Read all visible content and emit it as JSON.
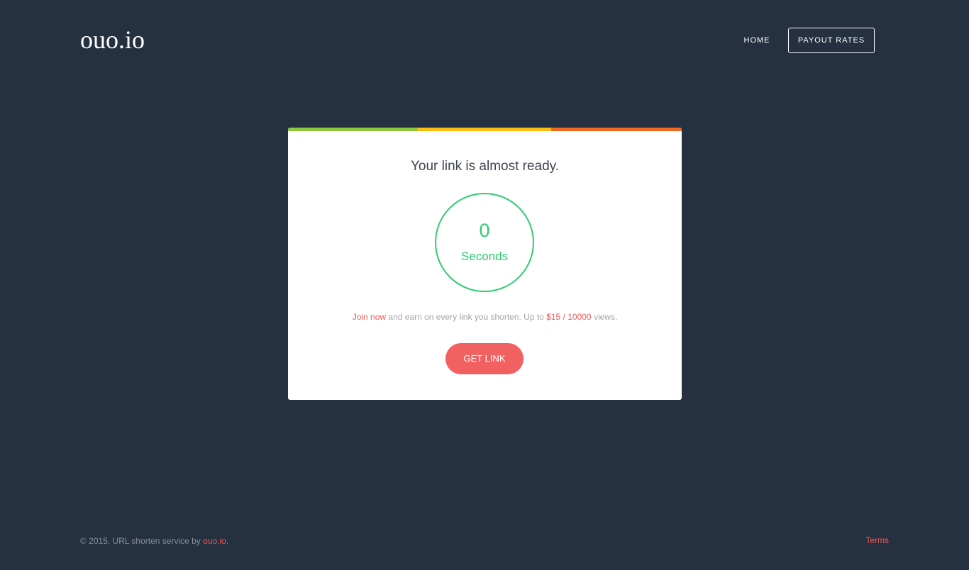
{
  "header": {
    "logo": "ouo.io",
    "nav": {
      "home": "HOME",
      "payout": "PAYOUT RATES"
    }
  },
  "card": {
    "bar_colors": {
      "green": "#8dc63f",
      "yellow": "#fbbc14",
      "orange": "#f26722"
    },
    "title": "Your link is almost ready.",
    "timer": {
      "value": "0",
      "unit": "Seconds"
    },
    "promo": {
      "join": "Join now",
      "middle": " and earn on every link you shorten. Up to ",
      "rate": "$15 / 10000",
      "end": " views."
    },
    "button": "GET LINK"
  },
  "footer": {
    "copyright": "© 2015. URL shorten service by ",
    "brand": "ouo.io.",
    "terms": "Terms"
  },
  "colors": {
    "background": "#253140",
    "accent_red": "#f26161",
    "timer_green": "#2ecc71"
  }
}
